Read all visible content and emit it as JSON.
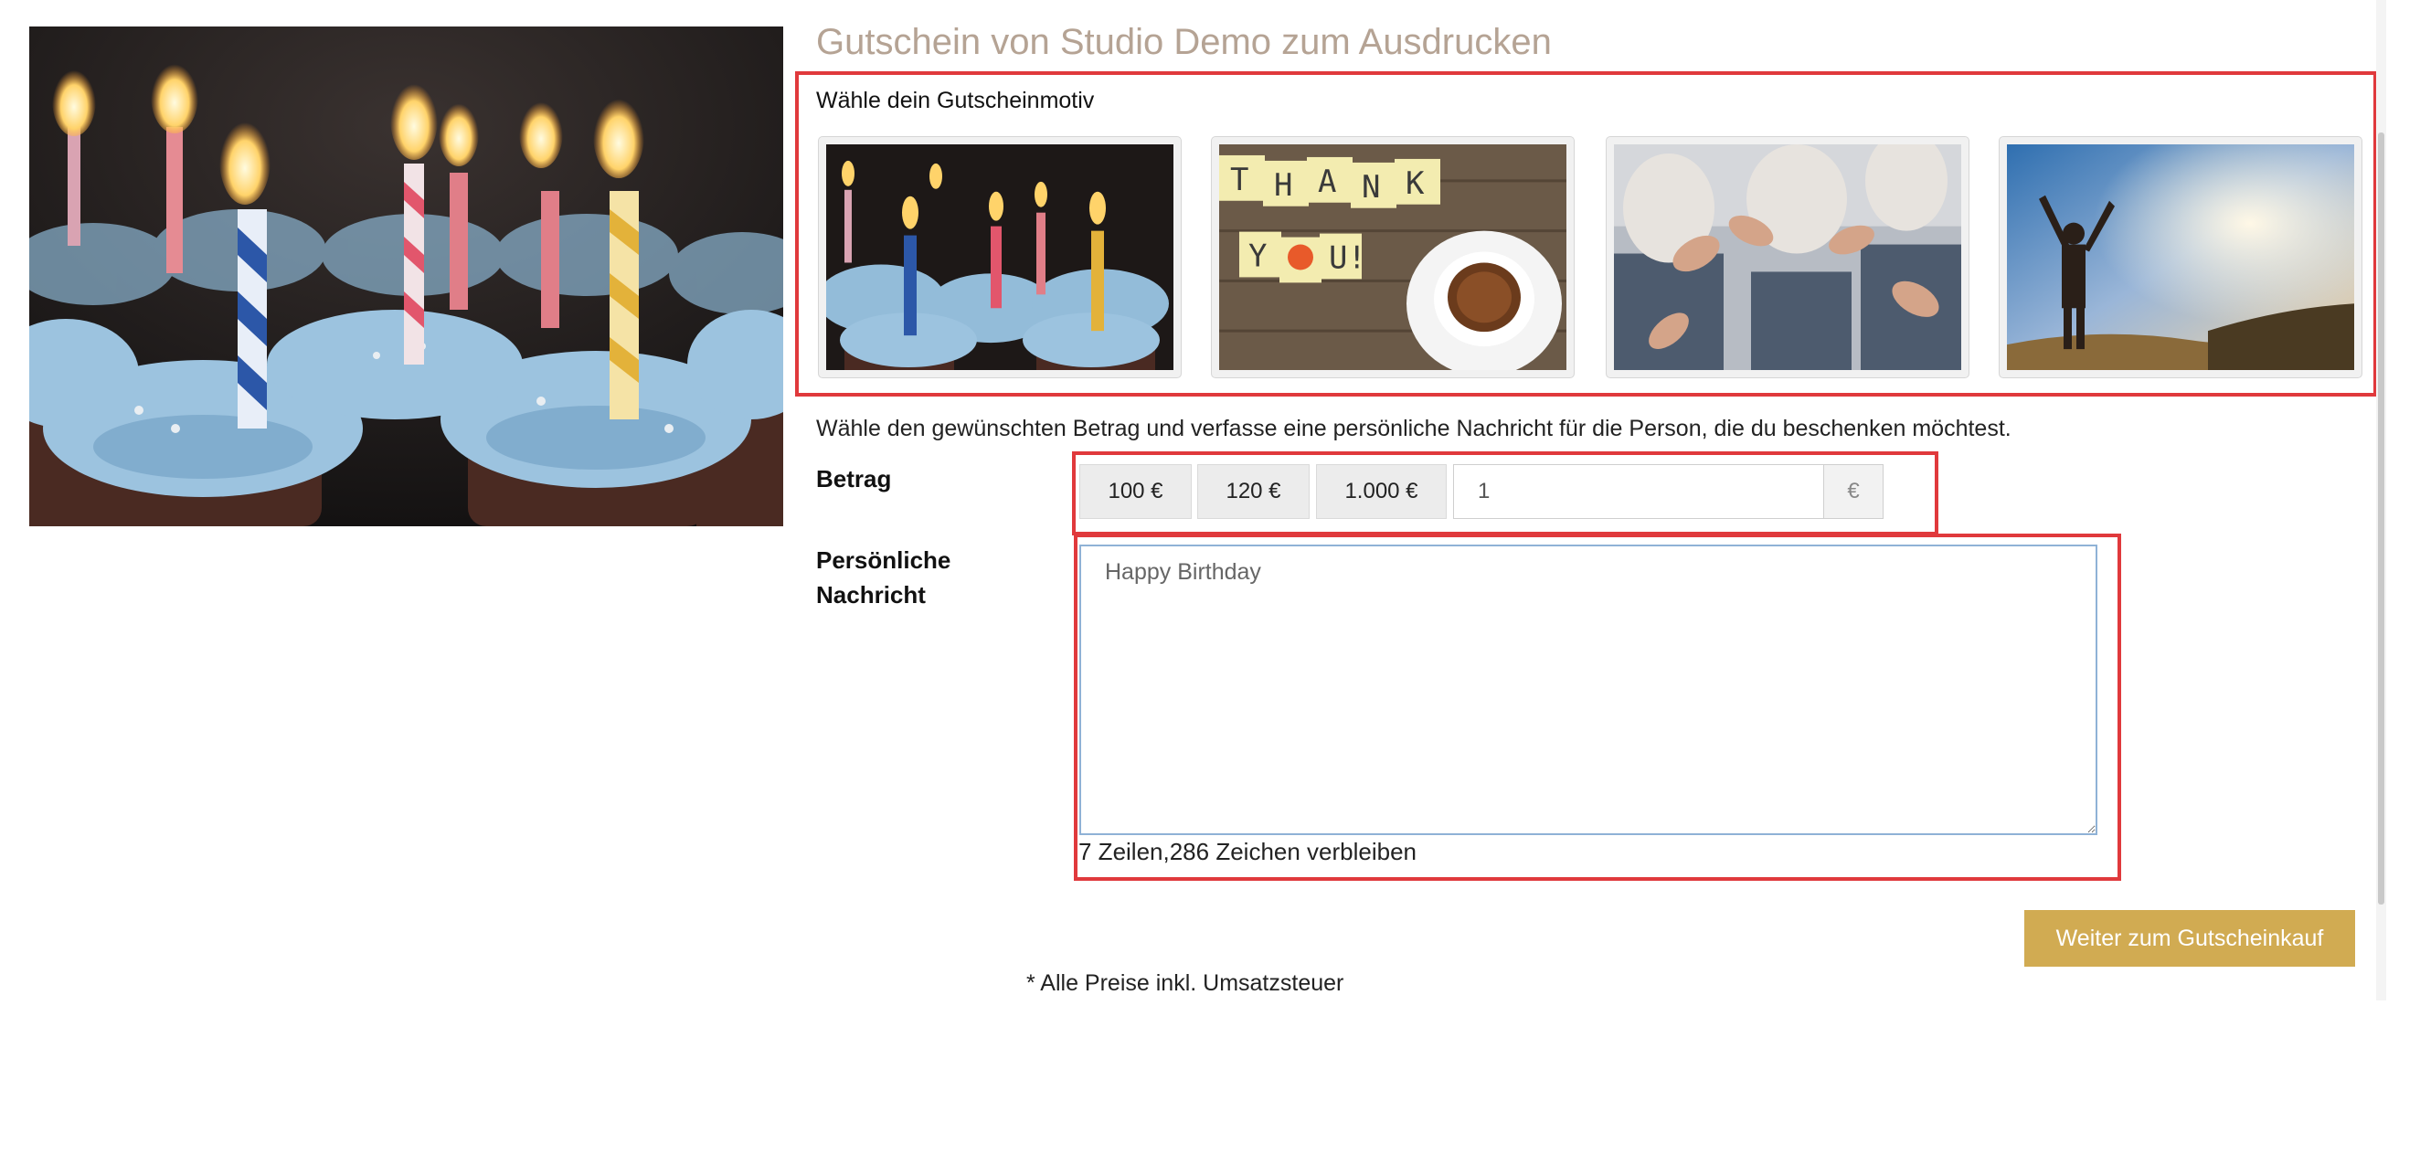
{
  "header": {
    "title": "Gutschein von Studio Demo zum Ausdrucken",
    "motif_label": "Wähle dein Gutscheinmotiv"
  },
  "motifs": [
    {
      "name": "birthday-candles"
    },
    {
      "name": "thank-you-coffee"
    },
    {
      "name": "group-clapping"
    },
    {
      "name": "sunset-freedom"
    }
  ],
  "intro_text": "Wähle den gewünschten Betrag und verfasse eine persönliche Nachricht für die Person, die du beschenken möchtest.",
  "amount": {
    "label": "Betrag",
    "options": [
      "100 €",
      "120 €",
      "1.000 €"
    ],
    "value": "1",
    "currency": "€"
  },
  "message": {
    "label_line1": "Persönliche",
    "label_line2": "Nachricht",
    "value": "Happy Birthday",
    "counter": "7 Zeilen,286 Zeichen verbleiben"
  },
  "actions": {
    "continue_label": "Weiter zum Gutscheinkauf"
  },
  "footnote": "* Alle Preise inkl. Umsatzsteuer",
  "colors": {
    "highlight": "#e0393c",
    "button": "#d1ab52",
    "title": "#b5a394"
  }
}
